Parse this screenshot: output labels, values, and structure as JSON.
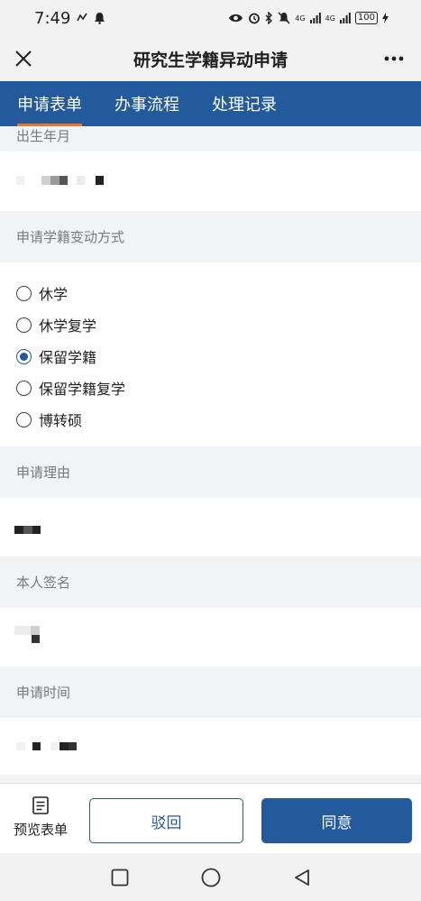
{
  "status_bar": {
    "time": "7:49",
    "battery": "100",
    "signal_label_1": "4G",
    "signal_label_2": "4G"
  },
  "header": {
    "title": "研究生学籍异动申请",
    "close_icon": "close-icon",
    "more_icon": "more-icon"
  },
  "tabs": [
    {
      "label": "申请表单",
      "active": true
    },
    {
      "label": "办事流程",
      "active": false
    },
    {
      "label": "处理记录",
      "active": false
    }
  ],
  "form": {
    "birth_label": "出生年月",
    "change_type_label": "申请学籍变动方式",
    "change_type_options": [
      {
        "label": "休学",
        "checked": false
      },
      {
        "label": "休学复学",
        "checked": false
      },
      {
        "label": "保留学籍",
        "checked": true
      },
      {
        "label": "保留学籍复学",
        "checked": false
      },
      {
        "label": "博转硕",
        "checked": false
      }
    ],
    "reason_label": "申请理由",
    "signature_label": "本人签名",
    "date_label": "申请时间"
  },
  "bottom": {
    "preview_label": "预览表单",
    "reject_label": "驳回",
    "agree_label": "同意"
  },
  "colors": {
    "brand": "#235a9c",
    "tab_indicator": "#e8762c"
  }
}
